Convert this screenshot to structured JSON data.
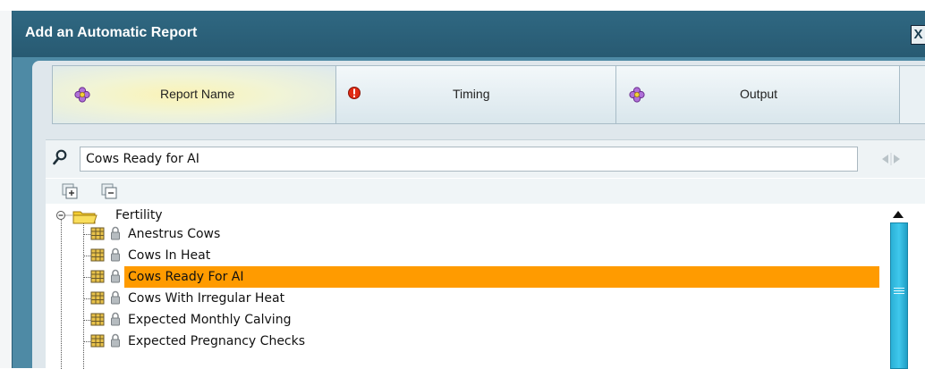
{
  "dialog": {
    "title": "Add an Automatic Report",
    "close_label": "X"
  },
  "tabs": [
    {
      "label": "Report Name",
      "icon": "flower-icon",
      "active": true
    },
    {
      "label": "Timing",
      "icon": "warning-icon",
      "active": false
    },
    {
      "label": "Output",
      "icon": "flower-icon",
      "active": false
    }
  ],
  "search": {
    "value": "Cows Ready for AI"
  },
  "tree": {
    "folder": {
      "label": "Fertility",
      "icon": "folder-icon"
    },
    "items": [
      {
        "label": "Anestrus Cows",
        "selected": false
      },
      {
        "label": "Cows In Heat",
        "selected": false
      },
      {
        "label": "Cows Ready For AI",
        "selected": true
      },
      {
        "label": "Cows With Irregular Heat",
        "selected": false
      },
      {
        "label": "Expected Monthly Calving",
        "selected": false
      },
      {
        "label": "Expected Pregnancy Checks",
        "selected": false
      }
    ]
  },
  "colors": {
    "titlebar": "#2f6882",
    "selection": "#ff9b00",
    "scrollbar": "#2ab0d6"
  }
}
